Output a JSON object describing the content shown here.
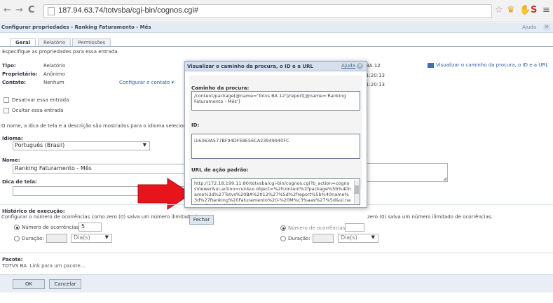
{
  "browser": {
    "url": "187.94.63.74/totvsba/cgi-bin/cognos.cgi#",
    "back_icon": "←",
    "forward_icon": "→",
    "reload_icon": "C"
  },
  "page": {
    "title": "Configurar propriedades - Ranking Faturamento - Mês",
    "help": "Ajuda",
    "tabs": [
      "Geral",
      "Relatório",
      "Permissões"
    ],
    "description": "Especifique as propriedades para essa entrada."
  },
  "general": {
    "tipo_label": "Tipo:",
    "tipo_value": "Relatório",
    "proprietario_label": "Proprietário:",
    "proprietario_value": "Anônimo",
    "contato_label": "Contato:",
    "contato_value": "Nenhum",
    "configurar_contato": "Configurar o contato ▾",
    "desativar": "Desativar essa entrada",
    "ocultar": "Ocultar essa entrada",
    "info_text": "O nome, a dica de tela e a descrição são mostrados para o idioma selecionado.",
    "right_partial_1": "BA 12",
    "right_partial_2": "1:20:13",
    "right_partial_3": "1:20:13",
    "view_path_link": "Visualizar o caminho da procura, o ID e a URL"
  },
  "fields": {
    "idioma_label": "Idioma:",
    "idioma_value": "Português (Brasil)",
    "nome_label": "Nome:",
    "nome_value": "Ranking Faturamento - Mês",
    "dica_label": "Dica de tela:"
  },
  "history": {
    "title": "Histórico de execução:",
    "desc": "Configurar o número de ocorrências como zero (0) salva um número ilimitado de o",
    "desc_right": "zero (0) salva um número ilimitado de ocorrências.",
    "num_label": "Número de ocorrências:",
    "num_value": "5",
    "duracao_label": "Duração:",
    "dias": "Dia(s)",
    "num_label_right": "Número de ocorrências:",
    "duracao_label_right": "Duração:",
    "dias_right": "Dia(s)"
  },
  "package": {
    "title": "Pacote:",
    "value": "TOTVS BA",
    "link": "Link para um pacote..."
  },
  "buttons": {
    "ok": "OK",
    "cancel": "Cancelar"
  },
  "dialog": {
    "title": "Visualizar o caminho da procura, o ID e a URL",
    "help": "Ajuda",
    "path_label": "Caminho da procura:",
    "path_value": "/content/package[@name='Totvs BA 12']/report[@name='Ranking Faturamento - Mês']",
    "id_label": "ID:",
    "id_value": "i16363A577BF94DFE8E56CA23949940FC",
    "url_label": "URL de ação padrão:",
    "url_value": "http://172.18.199.11:80/totvsba/cgi-bin/cognos.cgi?b_action=cognosViewer&ui.action=run&ui.object=%2fcontent%2fpackage%5b%40name%3d%27Totvs%20BA%2012%27%5d%2freport%5b%40name%3d%27Ranking%20Faturamento%20-%20M%c3%aas%27%5d&ui.name=Ranking%20Faturame",
    "close_button": "Fechar"
  },
  "colors": {
    "accent": "#2a5d9f",
    "arrow": "#e8141b"
  }
}
